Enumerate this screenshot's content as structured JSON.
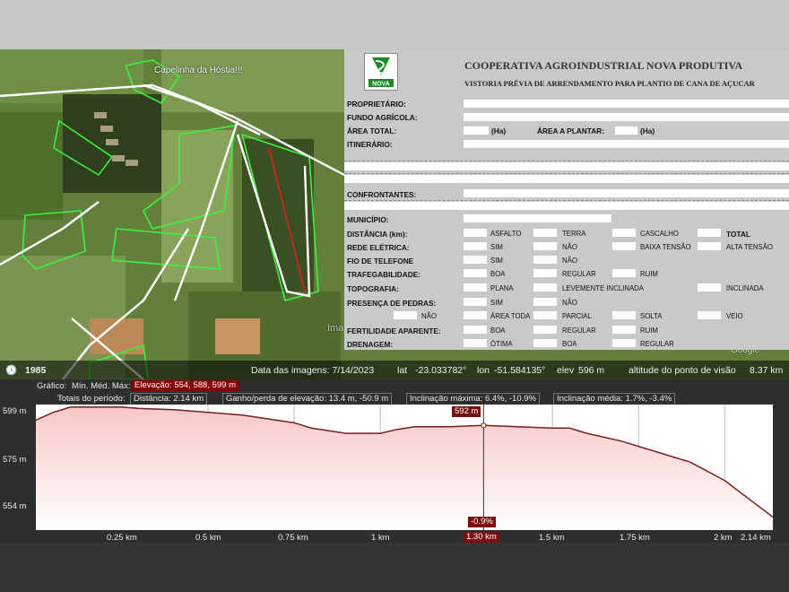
{
  "map": {
    "place_label": "Capelinha da Hóstia!!!",
    "watermark": "Ima",
    "corner_logo": "Google"
  },
  "status": {
    "year": "1985",
    "imagery_date": "Data das imagens: 7/14/2023",
    "lat_label": "lat",
    "lat": "-23.033782°",
    "lon_label": "lon",
    "lon": "-51.584135°",
    "elev_label": "elev",
    "elev": "596 m",
    "eye_label": "altitude do ponto de visão",
    "eye": "8.37 km"
  },
  "form": {
    "title": "COOPERATIVA AGROINDUSTRIAL NOVA PRODUTIVA",
    "subtitle": "VISTORIA PRÉVIA DE ARRENDAMENTO PARA PLANTIO DE CANA DE AÇUCAR",
    "logo_text": "NOVA",
    "proprietario": "PROPRIETÁRIO:",
    "fundo": "FUNDO AGRÍCOLA:",
    "area_total": "ÁREA TOTAL:",
    "ha": "(Ha)",
    "area_plantar": "ÁREA A PLANTAR:",
    "itinerario": "ITINERÁRIO:",
    "confrontantes": "CONFRONTANTES:",
    "municipio": "MUNICÍPIO:",
    "distancia": "DISTÂNCIA (km):",
    "asfalto": "ASFALTO",
    "terra": "TERRA",
    "cascalho": "CASCALHO",
    "total": "TOTAL",
    "rede": "REDE ELÉTRICA:",
    "sim": "SIM",
    "nao": "NÃO",
    "baixa": "BAIXA TENSÃO",
    "alta": "ALTA TENSÃO",
    "fio": "FIO DE TELEFONE",
    "traf": "TRAFEGABILIDADE:",
    "boa": "BOA",
    "regular": "REGULAR",
    "ruim": "RUIM",
    "topo": "TOPOGRAFIA:",
    "plana": "PLANA",
    "lev": "LEVEMENTE INCLINADA",
    "incl": "INCLINADA",
    "pedras": "PRESENÇA DE PEDRAS:",
    "area_toda": "ÁREA TODA",
    "parcial": "PARCIAL",
    "solta": "SOLTA",
    "veio": "VEIO",
    "fert": "FERTILIDADE APARENTE:",
    "dren": "DRENAGEM:",
    "otima": "ÓTIMA"
  },
  "profile": {
    "graph_label": "Gráfico:",
    "min_med_max": "Mín. Méd. Máx:",
    "elevation_box": "Elevação: 554, 588, 599 m",
    "totals_label": "Totais do período:",
    "distance_box": "Distância: 2.14 km",
    "gain_box": "Ganho/perda de elevação: 13.4 m, -50.9 m",
    "slope_max_box": "Inclinação máxima: 6.4%, -10.9%",
    "slope_avg_box": "Inclinação média: 1.7%, -3.4%",
    "y_ticks": [
      "599 m",
      "575 m",
      "554 m"
    ],
    "x_ticks": [
      "0.25 km",
      "0.5 km",
      "0.75 km",
      "1 km",
      "1.5 km",
      "1.75 km",
      "2 km",
      "2.14 km"
    ],
    "cursor_elev": "592 m",
    "cursor_slope": "-0.9%",
    "cursor_dist": "1.30 km",
    "colors": {
      "fill_top": "#f8c8c8",
      "fill_bottom": "#ffffff",
      "line": "#7a1d1d",
      "cursor_box": "#7a0f0f",
      "elev_box": "#8b0000"
    }
  },
  "chart_data": {
    "type": "area",
    "x": [
      0,
      0.05,
      0.1,
      0.15,
      0.2,
      0.25,
      0.3,
      0.4,
      0.5,
      0.6,
      0.7,
      0.75,
      0.8,
      0.9,
      1.0,
      1.05,
      1.1,
      1.2,
      1.3,
      1.4,
      1.5,
      1.55,
      1.6,
      1.7,
      1.8,
      1.9,
      2.0,
      2.05,
      2.1,
      2.14
    ],
    "y": [
      594,
      597,
      599,
      599,
      599,
      599,
      598.5,
      598,
      597,
      596,
      594,
      593,
      591,
      589,
      589,
      590.5,
      591.5,
      591.5,
      592,
      591.5,
      591,
      591,
      589,
      586,
      582,
      578,
      571,
      566,
      561,
      557
    ],
    "xlabel": "",
    "ylabel": "",
    "xlim": [
      0,
      2.14
    ],
    "ylim": [
      552,
      600
    ]
  }
}
